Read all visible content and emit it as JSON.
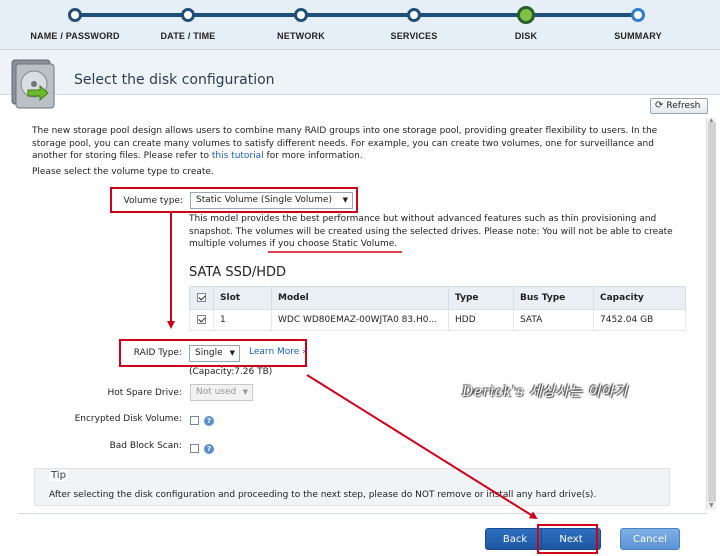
{
  "wizard": {
    "steps": [
      {
        "label": "NAME / PASSWORD"
      },
      {
        "label": "DATE / TIME"
      },
      {
        "label": "NETWORK"
      },
      {
        "label": "SERVICES"
      },
      {
        "label": "DISK"
      },
      {
        "label": "SUMMARY"
      }
    ],
    "active_step": "DISK"
  },
  "header": {
    "title": "Select the disk configuration",
    "icon": "disk-drive-icon"
  },
  "refresh": {
    "label": "Refresh",
    "icon": "refresh-icon"
  },
  "intro": {
    "text_before_link": "The new storage pool design allows users to combine many RAID groups into one storage pool, providing greater flexibility to users. In the storage pool, you can create many volumes to satisfy different needs. For example, you can create two volumes, one for surveillance and another for storing files. Please refer to ",
    "link": "this tutorial",
    "text_after_link": " for more information.",
    "please": "Please select the volume type to create."
  },
  "volume_type": {
    "label": "Volume type:",
    "value": "Static Volume (Single Volume)"
  },
  "volume_desc": "This model provides the best performance but without advanced features such as thin provisioning and snapshot. The volumes will be created using the selected drives. Please note: You will not be able to create multiple volumes if you choose Static Volume.",
  "drives": {
    "section_title": "SATA SSD/HDD",
    "columns": [
      "Slot",
      "Model",
      "Type",
      "Bus Type",
      "Capacity"
    ],
    "rows": [
      {
        "checked": true,
        "slot": "1",
        "model": "WDC WD80EMAZ-00WJTA0 83.H0...",
        "type": "HDD",
        "bus": "SATA",
        "capacity": "7452.04 GB"
      }
    ]
  },
  "raid": {
    "label": "RAID Type:",
    "value": "Single",
    "learn_more": "Learn More »",
    "capacity": "(Capacity:7.26 TB)"
  },
  "hot_spare": {
    "label": "Hot Spare Drive:",
    "value": "Not used"
  },
  "encrypted": {
    "label": "Encrypted Disk Volume:"
  },
  "bad_block": {
    "label": "Bad Block Scan:"
  },
  "tip": {
    "title": "Tip",
    "text": "After selecting the disk configuration and proceeding to the next step, please do NOT remove or install any hard drive(s)."
  },
  "watermark": "Derick's 세상사는 이야기",
  "buttons": {
    "back": "Back",
    "next": "Next",
    "cancel": "Cancel"
  },
  "colors": {
    "annotation_red": "#d0021b",
    "primary_blue": "#1d57a3",
    "active_step_green": "#7dc242"
  }
}
